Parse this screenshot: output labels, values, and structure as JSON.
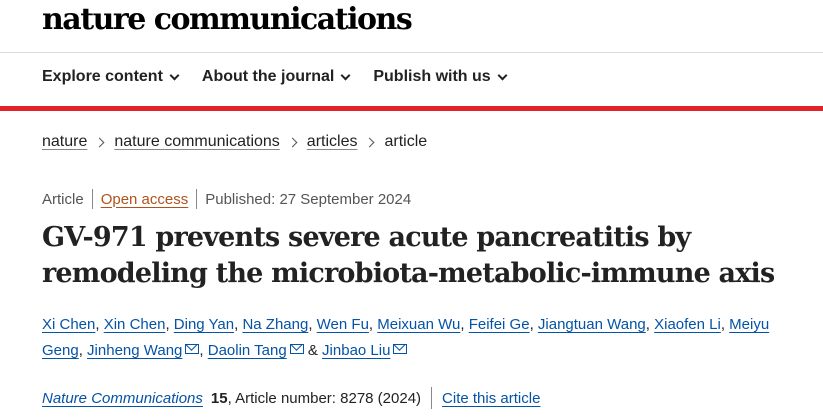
{
  "header": {
    "logo": "nature communications",
    "nav": [
      {
        "label": "Explore content"
      },
      {
        "label": "About the journal"
      },
      {
        "label": "Publish with us"
      }
    ],
    "accent_color": "#e0232a"
  },
  "breadcrumb": {
    "items": [
      "nature",
      "nature communications",
      "articles"
    ],
    "current": "article"
  },
  "meta": {
    "type": "Article",
    "access": "Open access",
    "published": "Published: 27 September 2024"
  },
  "article": {
    "title": "GV-971 prevents severe acute pancreatitis by remodeling the microbiota-metabolic-immune axis"
  },
  "authors": {
    "list": [
      "Xi Chen",
      "Xin Chen",
      "Ding Yan",
      "Na Zhang",
      "Wen Fu",
      "Meixuan Wu",
      "Feifei Ge",
      "Jiangtuan Wang",
      "Xiaofen Li",
      "Meiyu Geng",
      "Jinheng Wang",
      "Daolin Tang",
      "Jinbao Liu"
    ],
    "separator": ",",
    "conjunction": "&"
  },
  "citation": {
    "journal": "Nature Communications",
    "volume": "15",
    "details": ", Article number: 8278 (2024)",
    "cite_label": "Cite this article"
  },
  "colors": {
    "link": "#0553a6",
    "open_access": "#b0531b",
    "text": "#222222"
  }
}
